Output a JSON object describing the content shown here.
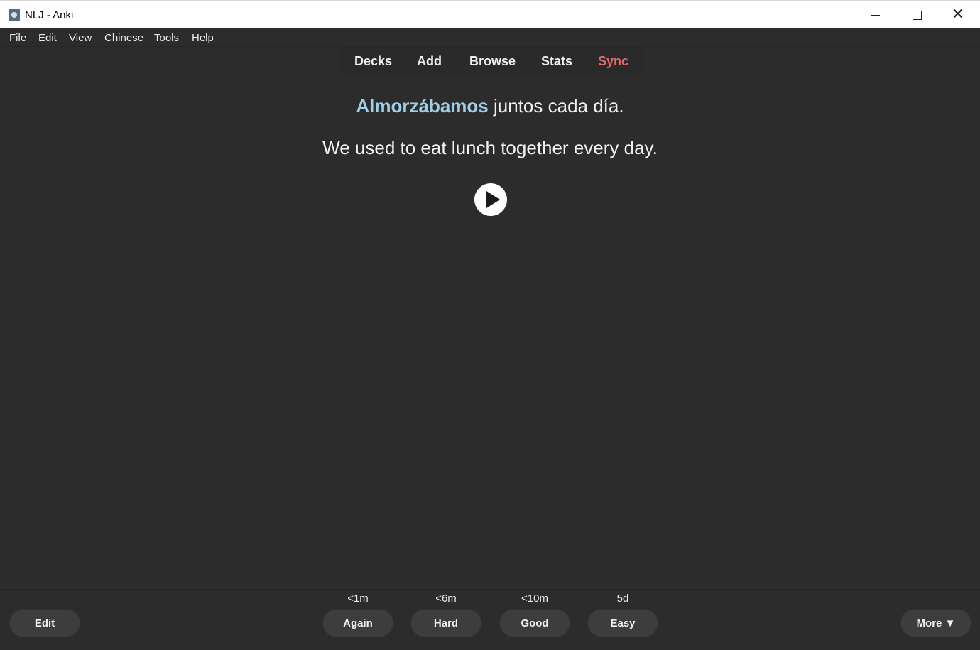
{
  "window": {
    "title": "NLJ - Anki",
    "icon": "anki-icon"
  },
  "menu": [
    "File",
    "Edit",
    "View",
    "Chinese",
    "Tools",
    "Help"
  ],
  "nav": {
    "decks": "Decks",
    "add": "Add",
    "browse": "Browse",
    "stats": "Stats",
    "sync": "Sync",
    "sync_color": "#e76b6b"
  },
  "card": {
    "front_highlight": "Almorzábamos",
    "front_rest": " juntos cada día.",
    "back": "We used to eat lunch together every day.",
    "highlight_color": "#9ecfe6",
    "audio_icon": "play-icon"
  },
  "bottom": {
    "edit": "Edit",
    "more": "More ▼",
    "answers": [
      {
        "label": "Again",
        "interval": "<1m"
      },
      {
        "label": "Hard",
        "interval": "<6m"
      },
      {
        "label": "Good",
        "interval": "<10m"
      },
      {
        "label": "Easy",
        "interval": "5d"
      }
    ]
  }
}
